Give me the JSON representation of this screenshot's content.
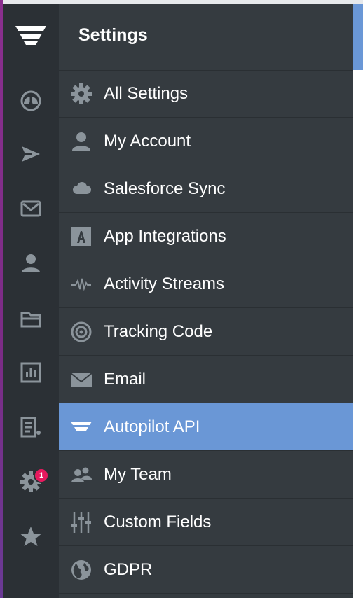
{
  "panel": {
    "title": "Settings"
  },
  "colors": {
    "rail_bg": "#2b3035",
    "panel_bg": "#353b40",
    "active_bg": "#6a97d6",
    "icon_gray": "#8b949b",
    "badge": "#e8195e"
  },
  "rail": {
    "items": [
      {
        "icon": "dashboard-gauge-icon"
      },
      {
        "icon": "send-paper-plane-icon"
      },
      {
        "icon": "mail-icon"
      },
      {
        "icon": "person-icon"
      },
      {
        "icon": "folder-icon"
      },
      {
        "icon": "report-chart-icon"
      },
      {
        "icon": "list-doc-icon"
      },
      {
        "icon": "gear-icon",
        "badge": "1"
      },
      {
        "icon": "star-icon"
      }
    ]
  },
  "menu": {
    "items": [
      {
        "label": "All Settings",
        "icon": "gear-icon"
      },
      {
        "label": "My Account",
        "icon": "person-icon"
      },
      {
        "label": "Salesforce Sync",
        "icon": "cloud-icon"
      },
      {
        "label": "App Integrations",
        "icon": "app-a-icon"
      },
      {
        "label": "Activity Streams",
        "icon": "pulse-icon"
      },
      {
        "label": "Tracking Code",
        "icon": "target-icon"
      },
      {
        "label": "Email",
        "icon": "envelope-icon"
      },
      {
        "label": "Autopilot API",
        "icon": "autopilot-logo-icon",
        "active": true
      },
      {
        "label": "My Team",
        "icon": "team-icon"
      },
      {
        "label": "Custom Fields",
        "icon": "sliders-icon"
      },
      {
        "label": "GDPR",
        "icon": "globe-icon"
      }
    ]
  }
}
